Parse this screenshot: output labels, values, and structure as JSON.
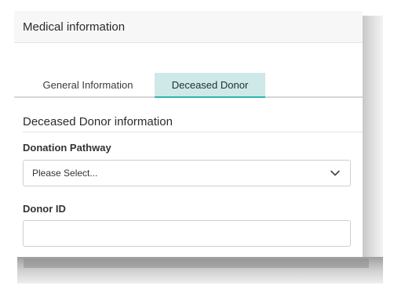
{
  "card": {
    "title": "Medical information"
  },
  "tabs": [
    {
      "label": "General Information",
      "active": false
    },
    {
      "label": "Deceased Donor",
      "active": true
    }
  ],
  "section": {
    "heading": "Deceased Donor information"
  },
  "fields": {
    "donation_pathway": {
      "label": "Donation Pathway",
      "value": "Please Select..."
    },
    "donor_id": {
      "label": "Donor ID",
      "value": "",
      "placeholder": ""
    }
  },
  "icons": {
    "select_chevron": "chevron-down-icon"
  },
  "colors": {
    "active_tab_bg": "#cfe8e8",
    "active_tab_accent": "#2fb3b3",
    "header_bg": "#f7f7f7"
  }
}
